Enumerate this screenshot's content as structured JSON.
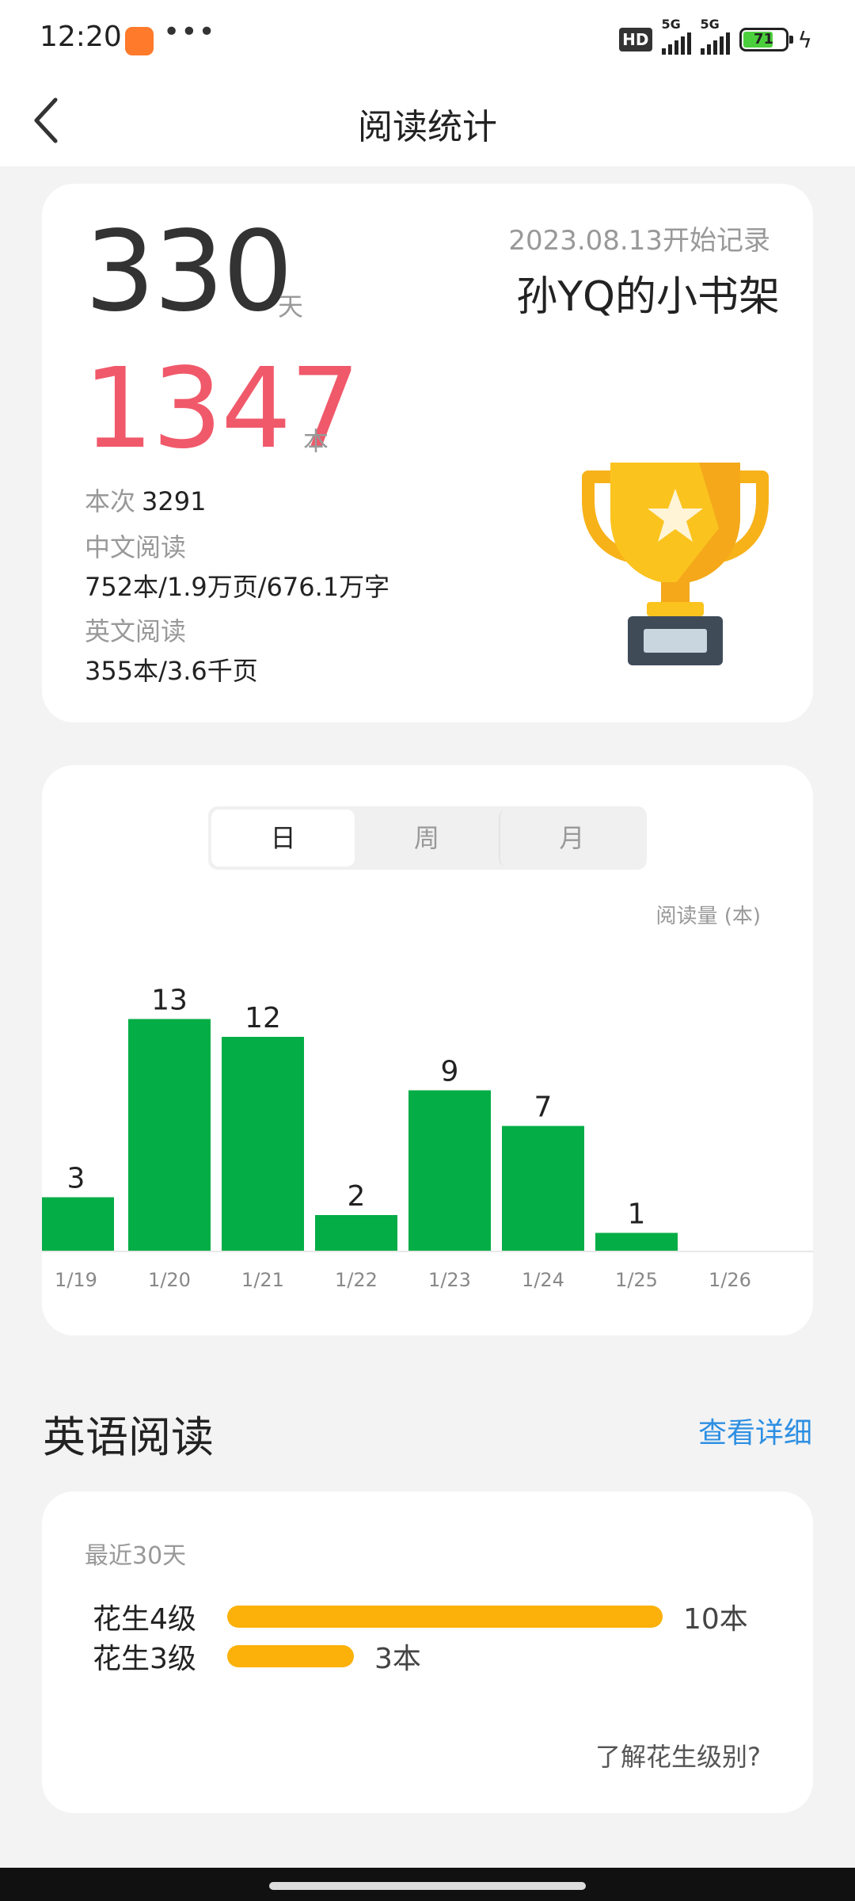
{
  "status_bar": {
    "time": "12:20",
    "more": "•••",
    "hd": "HD",
    "net1": "5G",
    "net2": "5G",
    "battery": "71"
  },
  "nav": {
    "title": "阅读统计"
  },
  "summary": {
    "days": "330",
    "days_unit": "天",
    "start_date": "2023.08.13开始记录",
    "shelf_name": "孙YQ的小书架",
    "books": "1347",
    "books_unit": "本",
    "times_label": "本次",
    "times_value": "3291",
    "cn_label": "中文阅读",
    "cn_value": "752本/1.9万页/676.1万字",
    "en_label": "英文阅读",
    "en_value": "355本/3.6千页",
    "trophy_icon": "trophy-icon"
  },
  "chart_tabs": [
    "日",
    "周",
    "月"
  ],
  "chart_data": {
    "type": "bar",
    "ylabel": "阅读量 (本)",
    "categories": [
      "1/19",
      "1/20",
      "1/21",
      "1/22",
      "1/23",
      "1/24",
      "1/25",
      "1/26"
    ],
    "values": [
      3,
      13,
      12,
      2,
      9,
      7,
      1,
      null
    ],
    "bar_color": "#04ad46",
    "grid": false
  },
  "english": {
    "section_title": "英语阅读",
    "detail_link": "查看详细",
    "recent_label": "最近30天",
    "levels": [
      {
        "name": "花生4级",
        "count": "10本",
        "value": 10
      },
      {
        "name": "花生3级",
        "count": "3本",
        "value": 3
      }
    ],
    "peanut_link": "了解花生级别?",
    "bar_color": "#fbb10a"
  }
}
